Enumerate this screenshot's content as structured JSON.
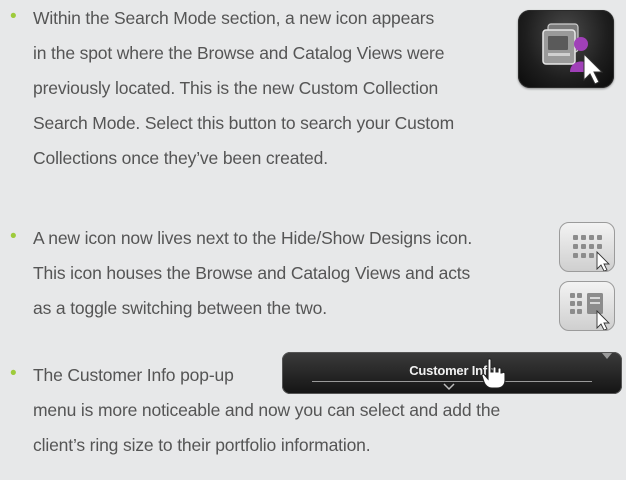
{
  "items": [
    {
      "lines": [
        "Within the Search Mode section, a new icon appears",
        "in the spot where the Browse and Catalog Views were",
        "previously located. This is the new Custom Collection",
        "Search Mode. Select this button to search your Custom",
        "Collections once they’ve been created."
      ]
    },
    {
      "lines": [
        "A new icon now lives next to the Hide/Show Designs icon.",
        "This icon houses the Browse and Catalog Views and acts",
        "as a toggle switching between the two."
      ]
    },
    {
      "lines": [
        "The Customer Info pop-up",
        "menu is more noticeable and now you can select and add the",
        "client’s ring size to their portfolio information."
      ]
    }
  ],
  "bullet_glyph": "•",
  "customer_info_label": "Customer Info",
  "colors": {
    "background": "#e7e8e9",
    "bullet": "#9ecb3b",
    "text": "#555555",
    "icon_accent": "#a040b8"
  },
  "icons": {
    "custom_collection": "custom-collection-search-icon",
    "browse_view": "browse-view-icon",
    "catalog_view": "catalog-view-icon",
    "cursor": "pointer-cursor-icon",
    "hand_cursor": "hand-cursor-icon"
  }
}
